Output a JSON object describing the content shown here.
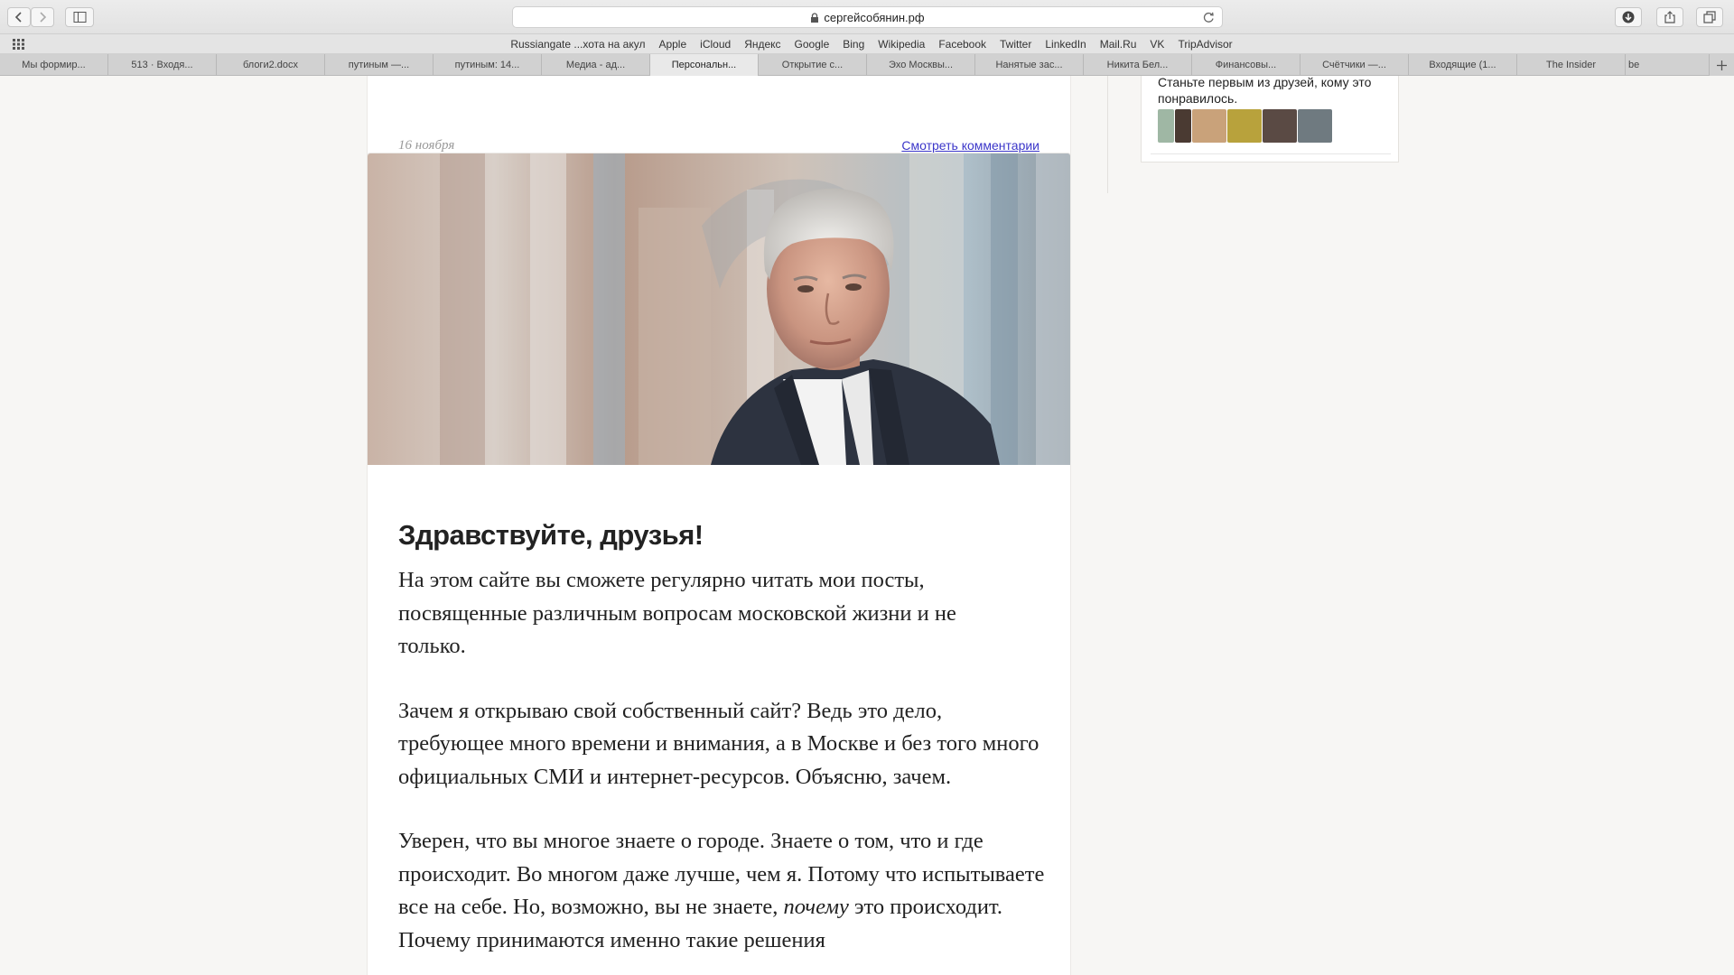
{
  "browser": {
    "url": "сергейсобянин.рф",
    "favorites": [
      "Russiangate ...хота на акул",
      "Apple",
      "iCloud",
      "Яндекс",
      "Google",
      "Bing",
      "Wikipedia",
      "Facebook",
      "Twitter",
      "LinkedIn",
      "Mail.Ru",
      "VK",
      "TripAdvisor"
    ],
    "tabs": [
      {
        "label": "Мы формир..."
      },
      {
        "label": "513 · Входя..."
      },
      {
        "label": "блоги2.docx"
      },
      {
        "label": "путиным —..."
      },
      {
        "label": "путиным: 14..."
      },
      {
        "label": "Медиа - ад..."
      },
      {
        "label": "Персональн..."
      },
      {
        "label": "Открытие с..."
      },
      {
        "label": "Эхо Москвы..."
      },
      {
        "label": "Нанятые зас..."
      },
      {
        "label": "Никита Бел..."
      },
      {
        "label": "Финансовы..."
      },
      {
        "label": "Счётчики —..."
      },
      {
        "label": "Входящие (1..."
      },
      {
        "label": "The Insider"
      },
      {
        "label": "be"
      }
    ],
    "active_tab_index": 6
  },
  "previous_post": {
    "date": "16 ноября",
    "comments_link": "Смотреть комментарии"
  },
  "article": {
    "title": "Здравствуйте, друзья!",
    "paragraph1": "На этом сайте вы сможете регулярно читать мои посты, посвященные различным вопросам московской жизни и не только.",
    "paragraph2": "Зачем я открываю свой собственный сайт? Ведь это дело, требующее много времени и внимания, а в Москве и без того много официальных СМИ и интернет-ресурсов. Объясню, зачем.",
    "paragraph3_start": "Уверен, что вы многое знаете о городе. Знаете о том, что и где происходит. Во многом даже лучше, чем я. Потому что испытываете все на себе. Но, возможно, вы не знаете, ",
    "paragraph3_emphasis": "почему",
    "paragraph3_end": " это происходит. Почему принимаются именно такие решения"
  },
  "facebook_widget": {
    "text": "Станьте первым из друзей, кому это понравилось.",
    "avatar_colors": [
      "#9fb7a4",
      "#4a3a32",
      "#c9a27a",
      "#b8a23c",
      "#5a4a44",
      "#6f7a80"
    ]
  }
}
